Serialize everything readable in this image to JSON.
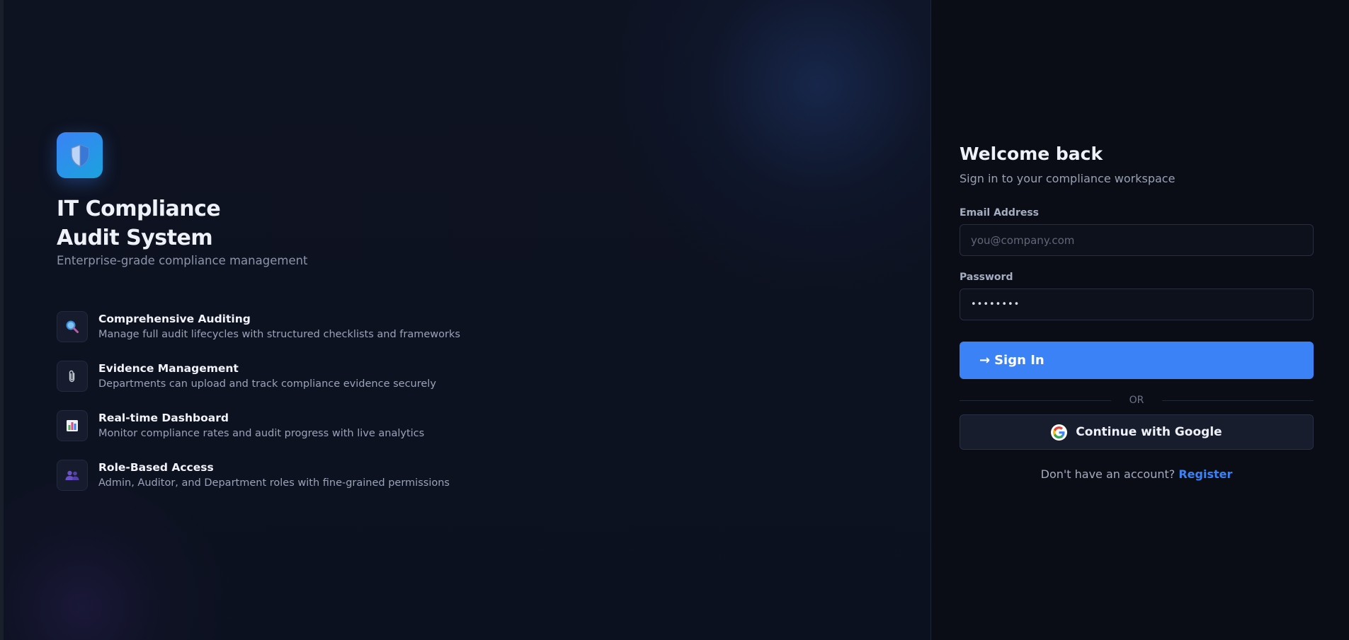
{
  "brand": {
    "icon": "shield-icon",
    "title_line1": "IT Compliance",
    "title_line2": "Audit System",
    "subtitle": "Enterprise-grade compliance management"
  },
  "features": [
    {
      "icon": "magnifier-icon",
      "title": "Comprehensive Auditing",
      "description": "Manage full audit lifecycles with structured checklists and frameworks"
    },
    {
      "icon": "paperclip-icon",
      "title": "Evidence Management",
      "description": "Departments can upload and track compliance evidence securely"
    },
    {
      "icon": "bar-chart-icon",
      "title": "Real-time Dashboard",
      "description": "Monitor compliance rates and audit progress with live analytics"
    },
    {
      "icon": "users-icon",
      "title": "Role-Based Access",
      "description": "Admin, Auditor, and Department roles with fine-grained permissions"
    }
  ],
  "form": {
    "title": "Welcome back",
    "subtitle": "Sign in to your compliance workspace",
    "email_label": "Email Address",
    "email_placeholder": "you@company.com",
    "email_value": "",
    "password_label": "Password",
    "password_value": "••••••••",
    "signin_arrow": "→",
    "signin_label": "Sign In",
    "divider_text": "OR",
    "google_label": "Continue with Google",
    "register_prompt": "Don't have an account?",
    "register_link": "Register"
  },
  "colors": {
    "accent": "#3b82f6",
    "background": "#0b0f1a",
    "muted_text": "#9aa3b7"
  }
}
